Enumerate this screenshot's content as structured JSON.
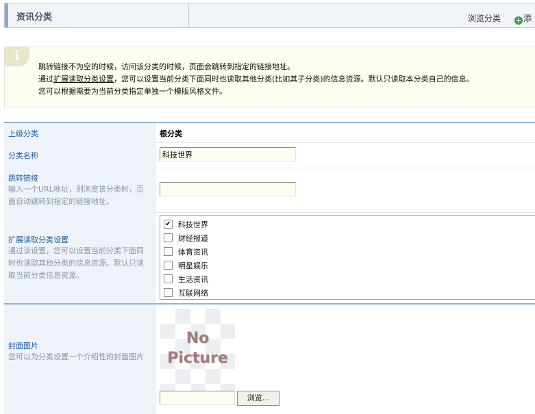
{
  "header": {
    "title": "资讯分类",
    "browse_label": "浏览分类",
    "add_label": "添"
  },
  "tips": {
    "line1": "跳转链接不为空的时候，访问该分类的时候，页面会跳转到指定的链接地址。",
    "line2_prefix": "通过",
    "line2_link": "扩展读取分类设置",
    "line2_suffix": "，您可以设置当前分类下面同时也读取其他分类(比如其子分类)的信息资源。默认只读取本分类自己的信息。",
    "line3": "您可以根据需要为当前分类指定单独一个模版风格文件。"
  },
  "form": {
    "parent": {
      "label": "上级分类",
      "value": "根分类"
    },
    "name": {
      "label": "分类名称",
      "value": "科技世界"
    },
    "redirect": {
      "label": "跳转链接",
      "desc": "输入一个URL地址，则浏览该分类时，页面自动跳转到指定的链接地址。",
      "value": ""
    },
    "extend": {
      "label": "扩展读取分类设置",
      "desc": "通过该设置，您可以设置当前分类下面同时也读取其他分类的信息资源。默认只读取当前分类信息资源。",
      "options": [
        {
          "label": "科技世界",
          "checked": true
        },
        {
          "label": "财经报道",
          "checked": false
        },
        {
          "label": "体育资讯",
          "checked": false
        },
        {
          "label": "明星娱乐",
          "checked": false
        },
        {
          "label": "生活资讯",
          "checked": false
        },
        {
          "label": "互联网络",
          "checked": false
        }
      ]
    },
    "cover": {
      "label": "封面图片",
      "desc": "您可以为分类设置一个介绍性的封面图片",
      "placeholder_line1": "No",
      "placeholder_line2": "Picture",
      "browse_button": "浏览..."
    }
  }
}
